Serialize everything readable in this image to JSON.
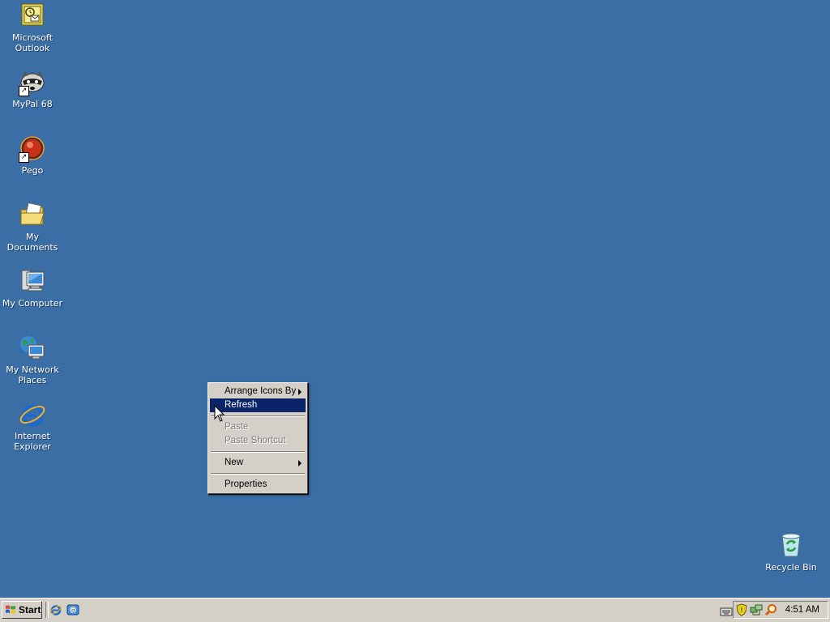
{
  "desktop": {
    "background": "#3a6ea5",
    "icons": [
      {
        "label_lines": [
          "Microsoft",
          "Outlook"
        ],
        "icon": "outlook-icon"
      },
      {
        "label_lines": [
          "MyPal 68"
        ],
        "icon": "raccoon-icon",
        "shortcut": true
      },
      {
        "label_lines": [
          "Pego"
        ],
        "icon": "pego-icon",
        "shortcut": true
      },
      {
        "label_lines": [
          "My Documents"
        ],
        "icon": "folder-icon"
      },
      {
        "label_lines": [
          "My Computer"
        ],
        "icon": "computer-icon"
      },
      {
        "label_lines": [
          "My Network",
          "Places"
        ],
        "icon": "network-icon"
      },
      {
        "label_lines": [
          "Internet",
          "Explorer"
        ],
        "icon": "ie-icon"
      },
      {
        "label_lines": [
          "Recycle Bin"
        ],
        "icon": "recycle-bin-icon"
      }
    ]
  },
  "context_menu": {
    "items": [
      {
        "label": "Arrange Icons By",
        "submenu": true,
        "disabled": false,
        "highlighted": false
      },
      {
        "label": "Refresh",
        "submenu": false,
        "disabled": false,
        "highlighted": true
      },
      {
        "separator": true
      },
      {
        "label": "Paste",
        "submenu": false,
        "disabled": true,
        "highlighted": false
      },
      {
        "label": "Paste Shortcut",
        "submenu": false,
        "disabled": true,
        "highlighted": false
      },
      {
        "separator": true
      },
      {
        "label": "New",
        "submenu": true,
        "disabled": false,
        "highlighted": false
      },
      {
        "separator": true
      },
      {
        "label": "Properties",
        "submenu": false,
        "disabled": false,
        "highlighted": false
      }
    ],
    "highlight_color": "#0a246a"
  },
  "taskbar": {
    "start_label": "Start",
    "quick_launch": [
      "ie-icon",
      "outlook-express-icon"
    ],
    "tray_icons": [
      "keyboard-icon",
      "shield-icon",
      "network-tray-icon",
      "search-tray-icon"
    ],
    "clock": "4:51 AM"
  }
}
